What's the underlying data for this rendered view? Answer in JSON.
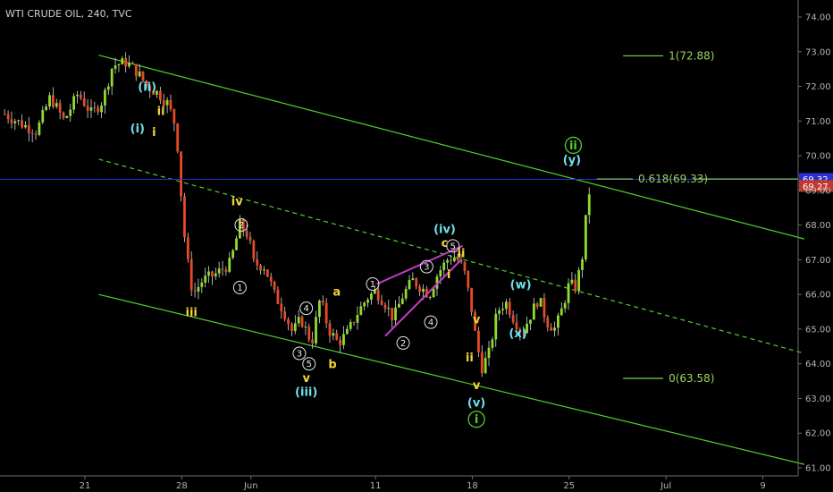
{
  "header": {
    "title": "WTI CRUDE OIL, 240, TVC"
  },
  "colors": {
    "background": "#000000",
    "up": "#8fdc2c",
    "down": "#e84a24",
    "channel": "#4fd12a",
    "wedge": "#c83cc8",
    "hline": "#2a2fd0",
    "fib": "#7fd34a",
    "axis_text": "#b3b3b3",
    "label_white": "#e6e6e6",
    "label_yellow": "#f2d43a",
    "label_cyan": "#6fe0e8",
    "label_green": "#4fd12a"
  },
  "chart_data": {
    "type": "candlestick",
    "title": "WTI CRUDE OIL, 240, TVC",
    "ylim": [
      61.0,
      74.0
    ],
    "y_ticks": [
      "74.00",
      "73.00",
      "72.00",
      "71.00",
      "70.00",
      "69.00",
      "68.00",
      "67.00",
      "66.00",
      "65.00",
      "64.00",
      "63.00",
      "62.00",
      "61.00"
    ],
    "x_ticks": [
      {
        "label": "21",
        "day": 21
      },
      {
        "label": "28",
        "day": 28
      },
      {
        "label": "Jun",
        "day": 33
      },
      {
        "label": "11",
        "day": 42
      },
      {
        "label": "18",
        "day": 49
      },
      {
        "label": "25",
        "day": 56
      },
      {
        "label": "Jul",
        "day": 63
      },
      {
        "label": "9",
        "day": 70
      }
    ],
    "day_range": [
      15,
      73
    ],
    "price_path": [
      [
        15.2,
        71.2
      ],
      [
        16.5,
        70.9
      ],
      [
        17.5,
        70.7
      ],
      [
        18.5,
        71.7
      ],
      [
        19.5,
        71.0
      ],
      [
        20.5,
        71.8
      ],
      [
        21.5,
        71.2
      ],
      [
        22.3,
        71.6
      ],
      [
        23,
        72.6
      ],
      [
        24,
        72.7
      ],
      [
        24.8,
        72.4
      ],
      [
        25.5,
        72.0
      ],
      [
        26.3,
        71.8
      ],
      [
        27,
        71.5
      ],
      [
        27.6,
        70.8
      ],
      [
        27.9,
        69.2
      ],
      [
        28.1,
        68.0
      ],
      [
        28.4,
        67.0
      ],
      [
        28.8,
        66.0
      ],
      [
        29.5,
        66.4
      ],
      [
        30.5,
        66.6
      ],
      [
        31.5,
        66.9
      ],
      [
        32.2,
        68.0
      ],
      [
        32.8,
        67.7
      ],
      [
        33.2,
        66.9
      ],
      [
        34,
        66.8
      ],
      [
        34.7,
        66.0
      ],
      [
        35.4,
        65.5
      ],
      [
        36,
        64.9
      ],
      [
        36.6,
        65.3
      ],
      [
        37.4,
        64.6
      ],
      [
        38,
        65.9
      ],
      [
        38.6,
        65.0
      ],
      [
        39.3,
        64.6
      ],
      [
        40,
        64.9
      ],
      [
        40.6,
        65.4
      ],
      [
        41.4,
        65.9
      ],
      [
        42,
        66.1
      ],
      [
        42.6,
        65.8
      ],
      [
        43.3,
        65.3
      ],
      [
        44,
        66.0
      ],
      [
        44.7,
        66.4
      ],
      [
        45.3,
        66.2
      ],
      [
        45.9,
        66.0
      ],
      [
        46.5,
        66.6
      ],
      [
        47.2,
        67.0
      ],
      [
        47.8,
        67.1
      ],
      [
        48.4,
        66.7
      ],
      [
        48.9,
        65.7
      ],
      [
        49.3,
        64.6
      ],
      [
        49.7,
        63.9
      ],
      [
        50.2,
        64.3
      ],
      [
        50.8,
        65.5
      ],
      [
        51.4,
        65.8
      ],
      [
        52,
        65.3
      ],
      [
        52.6,
        64.9
      ],
      [
        53.2,
        65.4
      ],
      [
        53.8,
        65.9
      ],
      [
        54.4,
        65.2
      ],
      [
        55,
        65.0
      ],
      [
        55.5,
        65.6
      ],
      [
        56,
        66.3
      ],
      [
        56.5,
        66.2
      ],
      [
        57,
        67.2
      ],
      [
        57.3,
        68.6
      ],
      [
        57.6,
        69.3
      ]
    ],
    "channel_lines": [
      {
        "name": "upper",
        "p1": [
          22,
          72.9
        ],
        "p2": [
          73,
          67.6
        ]
      },
      {
        "name": "mid",
        "p1": [
          22,
          69.9
        ],
        "p2": [
          73,
          64.3
        ]
      },
      {
        "name": "lower",
        "p1": [
          22,
          66.0
        ],
        "p2": [
          73,
          61.1
        ]
      }
    ],
    "wedge_lines": [
      {
        "p1": [
          42.1,
          66.3
        ],
        "p2": [
          48.3,
          67.4
        ]
      },
      {
        "p1": [
          42.7,
          64.8
        ],
        "p2": [
          48.2,
          67.0
        ]
      }
    ],
    "hline": {
      "price": 69.32,
      "label": "69.32"
    },
    "last_price": {
      "price": 69.27,
      "label": "69.27"
    },
    "fib_levels": [
      {
        "label": "1(72.88)",
        "price": 72.88,
        "d1": 59.9,
        "d2": 62.8
      },
      {
        "label": "0.618(69.33)",
        "price": 69.33,
        "d1": 58.0,
        "d2": 60.6
      },
      {
        "label": "0(63.58)",
        "price": 63.58,
        "d1": 59.9,
        "d2": 62.8
      }
    ],
    "wave_labels": [
      {
        "text": "(ii)",
        "day": 25.5,
        "price": 72.0,
        "color": "cyan"
      },
      {
        "text": "(i)",
        "day": 24.8,
        "price": 70.8,
        "color": "cyan"
      },
      {
        "text": "ii",
        "day": 26.5,
        "price": 71.3,
        "color": "yellow"
      },
      {
        "text": "i",
        "day": 26.0,
        "price": 70.7,
        "color": "yellow"
      },
      {
        "text": "iv",
        "day": 32.0,
        "price": 68.7,
        "color": "yellow"
      },
      {
        "text": "iii",
        "day": 28.7,
        "price": 65.5,
        "color": "yellow"
      },
      {
        "text": "a",
        "day": 39.2,
        "price": 66.1,
        "color": "yellow"
      },
      {
        "text": "b",
        "day": 38.9,
        "price": 64.0,
        "color": "yellow"
      },
      {
        "text": "v",
        "day": 37.0,
        "price": 63.6,
        "color": "yellow"
      },
      {
        "text": "(iii)",
        "day": 37.0,
        "price": 63.2,
        "color": "cyan"
      },
      {
        "text": "(iv)",
        "day": 47.0,
        "price": 67.9,
        "color": "cyan"
      },
      {
        "text": "c",
        "day": 47.0,
        "price": 67.5,
        "color": "yellow"
      },
      {
        "text": "ii",
        "day": 48.2,
        "price": 67.2,
        "color": "yellow"
      },
      {
        "text": "i",
        "day": 47.3,
        "price": 66.6,
        "color": "yellow"
      },
      {
        "text": "v",
        "day": 49.3,
        "price": 65.3,
        "color": "yellow"
      },
      {
        "text": "ii",
        "day": 48.8,
        "price": 64.2,
        "color": "yellow"
      },
      {
        "text": "v",
        "day": 49.3,
        "price": 63.4,
        "color": "yellow"
      },
      {
        "text": "(v)",
        "day": 49.3,
        "price": 62.9,
        "color": "cyan"
      },
      {
        "text": "(w)",
        "day": 52.5,
        "price": 66.3,
        "color": "cyan"
      },
      {
        "text": "(x)",
        "day": 52.3,
        "price": 64.9,
        "color": "cyan"
      },
      {
        "text": "(y)",
        "day": 56.2,
        "price": 69.9,
        "color": "cyan"
      }
    ],
    "circle_labels": [
      {
        "text": "2",
        "day": 32.3,
        "price": 68.0
      },
      {
        "text": "1",
        "day": 32.2,
        "price": 66.2
      },
      {
        "text": "4",
        "day": 37.0,
        "price": 65.6
      },
      {
        "text": "3",
        "day": 36.5,
        "price": 64.3
      },
      {
        "text": "5",
        "day": 37.2,
        "price": 64.0
      },
      {
        "text": "1",
        "day": 41.8,
        "price": 66.3
      },
      {
        "text": "3",
        "day": 45.7,
        "price": 66.8
      },
      {
        "text": "4",
        "day": 46.0,
        "price": 65.2
      },
      {
        "text": "2",
        "day": 44.0,
        "price": 64.6
      },
      {
        "text": "5",
        "day": 47.6,
        "price": 67.4
      }
    ],
    "big_circle_labels": [
      {
        "text": "ii",
        "day": 56.3,
        "price": 70.3
      },
      {
        "text": "i",
        "day": 49.3,
        "price": 62.4
      }
    ]
  }
}
